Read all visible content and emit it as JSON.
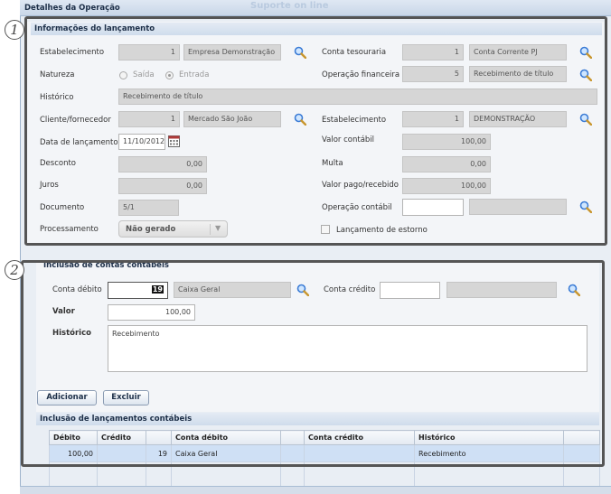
{
  "window": {
    "title": "Detalhes da Operação",
    "ghost_text": "Suporte on line"
  },
  "section1": {
    "number": "1",
    "header": "Informações do lançamento",
    "estabelecimento": {
      "label": "Estabelecimento",
      "code": "1",
      "name": "Empresa Demonstração"
    },
    "conta_tesouraria": {
      "label": "Conta tesouraria",
      "code": "1",
      "name": "Conta Corrente PJ"
    },
    "natureza": {
      "label": "Natureza",
      "option_saida": "Saída",
      "option_entrada": "Entrada"
    },
    "operacao_financeira": {
      "label": "Operação financeira",
      "code": "5",
      "name": "Recebimento de título"
    },
    "historico": {
      "label": "Histórico",
      "value": "Recebimento de título"
    },
    "cliente": {
      "label": "Cliente/fornecedor",
      "code": "1",
      "name": "Mercado São João"
    },
    "estabelecimento2": {
      "label": "Estabelecimento",
      "code": "1",
      "name": "DEMONSTRAÇÃO"
    },
    "data_lancamento": {
      "label": "Data de lançamento",
      "value": "11/10/2012"
    },
    "valor_contabil": {
      "label": "Valor contábil",
      "value": "100,00"
    },
    "desconto": {
      "label": "Desconto",
      "value": "0,00"
    },
    "multa": {
      "label": "Multa",
      "value": "0,00"
    },
    "juros": {
      "label": "Juros",
      "value": "0,00"
    },
    "valor_pago": {
      "label": "Valor pago/recebido",
      "value": "100,00"
    },
    "documento": {
      "label": "Documento",
      "value": "5/1"
    },
    "operacao_contabil": {
      "label": "Operação contábil",
      "value": "",
      "name": ""
    },
    "processamento": {
      "label": "Processamento",
      "value": "Não gerado"
    },
    "estorno": {
      "label": "Lançamento de estorno"
    }
  },
  "section2": {
    "number": "2",
    "header": "Inclusão de contas contábeis",
    "conta_debito": {
      "label": "Conta débito",
      "code": "19",
      "name": "Caixa Geral"
    },
    "conta_credito": {
      "label": "Conta crédito",
      "code": "",
      "name": ""
    },
    "valor": {
      "label": "Valor",
      "value": "100,00"
    },
    "historico": {
      "label": "Histórico",
      "value": "Recebimento"
    },
    "buttons": {
      "adicionar": "Adicionar",
      "excluir": "Excluir"
    },
    "table_header": "Inclusão de lançamentos contábeis",
    "columns": [
      "Débito",
      "Crédito",
      "",
      "Conta débito",
      "",
      "Conta crédito",
      "Histórico",
      ""
    ],
    "rows": [
      [
        "100,00",
        "",
        "19",
        "Caixa Geral",
        "",
        "",
        "Recebimento",
        ""
      ]
    ]
  },
  "colors": {
    "frame": "#555555",
    "header_text": "#1d2f48",
    "readonly_fill": "#d6d6d6"
  },
  "icons": {
    "lookup": "magnifier-icon",
    "calendar": "calendar-icon",
    "dropdown": "chevron-down-icon"
  }
}
